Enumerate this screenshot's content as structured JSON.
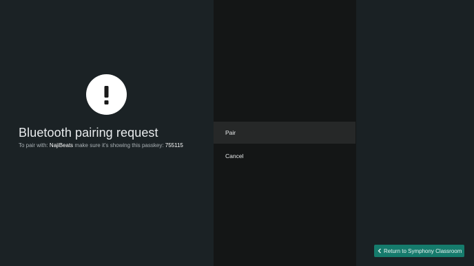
{
  "dialog": {
    "icon": "exclamation-icon",
    "title": "Bluetooth pairing request",
    "message_prefix": "To pair with:",
    "device_name": "NajiBeats",
    "message_middle": "make sure it's showing this passkey:",
    "passkey": "755115"
  },
  "menu": {
    "items": [
      {
        "label": "Pair",
        "focused": true
      },
      {
        "label": "Cancel",
        "focused": false
      }
    ]
  },
  "footer": {
    "return_icon": "chevron-left-icon",
    "return_label": "Return to Symphony Classroom"
  },
  "colors": {
    "background": "#1a2124",
    "menu_panel": "#141616",
    "menu_focus": "#262828",
    "return_button": "#157b6c"
  }
}
